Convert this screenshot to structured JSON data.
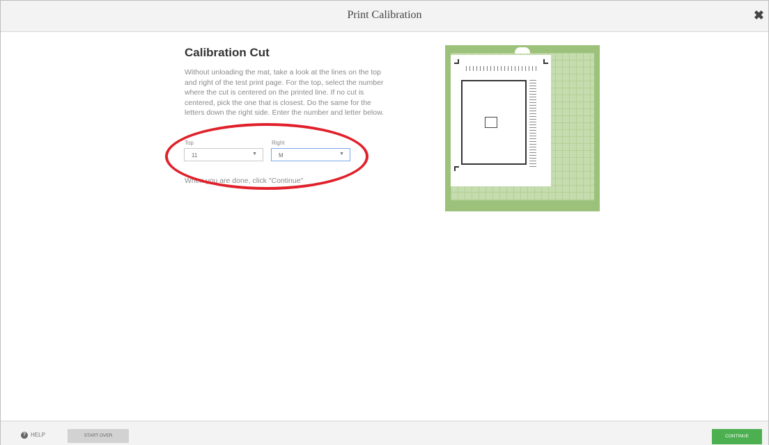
{
  "window": {
    "title": "Print Calibration",
    "close_glyph": "✖"
  },
  "main": {
    "heading": "Calibration Cut",
    "instructions": "Without unloading the mat, take a look at the lines on the top and right of the test print page. For the top, select the number where the cut is centered on the printed line. If no cut is centered, pick the one that is closest. Do the same for the letters down the right side. Enter the number and letter below.",
    "top_field": {
      "label": "Top",
      "value": "11"
    },
    "right_field": {
      "label": "Right",
      "value": "M"
    },
    "done_text": "When you are done, click \"Continue\""
  },
  "footer": {
    "help_label": "HELP",
    "help_icon_glyph": "?",
    "start_over_label": "START OVER",
    "continue_label": "CONTINUE"
  },
  "colors": {
    "mat_green": "#9cc17a",
    "continue_green": "#4caf50",
    "highlight_red": "#e0202a"
  },
  "icons": [
    "close-icon",
    "help-icon",
    "dropdown-arrow-icon"
  ]
}
